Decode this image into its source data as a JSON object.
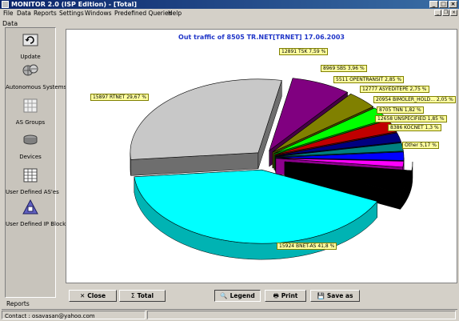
{
  "window": {
    "title": "MONITOR 2.0  (ISP Edition) - [Total]",
    "min": "_",
    "max": "□",
    "close": "×"
  },
  "menu": {
    "items": [
      "File",
      "Data",
      "Reports",
      "Settings",
      "Windows",
      "Predefined Queries",
      "Help"
    ]
  },
  "mdi_controls": {
    "min": "_",
    "restore": "❐",
    "close": "×"
  },
  "sidebar": {
    "header": "Data",
    "items": [
      {
        "label": "Update",
        "icon": "update-icon"
      },
      {
        "label": "Autonomous Systems",
        "icon": "globe-network-icon"
      },
      {
        "label": "AS Groups",
        "icon": "grid-icon"
      },
      {
        "label": "Devices",
        "icon": "router-device-icon"
      },
      {
        "label": "User Defined AS'es",
        "icon": "table-icon"
      },
      {
        "label": "User Defined IP Blocks",
        "icon": "ip-blocks-icon"
      }
    ],
    "footer": "Reports"
  },
  "chart_title": "Out traffic of 8505 TR.NET[TRNET] 17.06.2003",
  "chart_data": {
    "type": "pie",
    "title": "Out traffic of 8505 TR.NET[TRNET] 17.06.2003",
    "slices": [
      {
        "label": "15924 BNET-AS 41,8 %",
        "value": 41.8,
        "color": "#00ffff"
      },
      {
        "label": "15897 RTNET 29,67 %",
        "value": 29.67,
        "color": "#c8c8c8"
      },
      {
        "label": "12891 TSK 7,59 %",
        "value": 7.59,
        "color": "#800080"
      },
      {
        "label": "8969 SBS 3,96 %",
        "value": 3.96,
        "color": "#808000"
      },
      {
        "label": "5511 OPENTRANSIT 2,85 %",
        "value": 2.85,
        "color": "#00ff00"
      },
      {
        "label": "12777 ASYEDITEPE 2,75 %",
        "value": 2.75,
        "color": "#c00000"
      },
      {
        "label": "20954 BIMOLER_HOLD... 2,05 %",
        "value": 2.05,
        "color": "#000080"
      },
      {
        "label": "8705 TNN 1,82 %",
        "value": 1.82,
        "color": "#008080"
      },
      {
        "label": "12658 UNSPECIFIED 1,85 %",
        "value": 1.85,
        "color": "#0000ff"
      },
      {
        "label": "8386 KOCNET 1,3 %",
        "value": 1.3,
        "color": "#ff00ff"
      },
      {
        "label": "Other 5,17 %",
        "value": 5.17,
        "color": "#000000"
      }
    ]
  },
  "buttons": {
    "close": "Close",
    "total": "Total",
    "legend": "Legend",
    "print": "Print",
    "save_as": "Save as"
  },
  "button_glyphs": {
    "close": "✕",
    "total": "Σ",
    "legend": "🔍",
    "print": "🖶",
    "save_as": "💾"
  },
  "status": {
    "contact": "Contact : osavasan@yahoo.com"
  }
}
